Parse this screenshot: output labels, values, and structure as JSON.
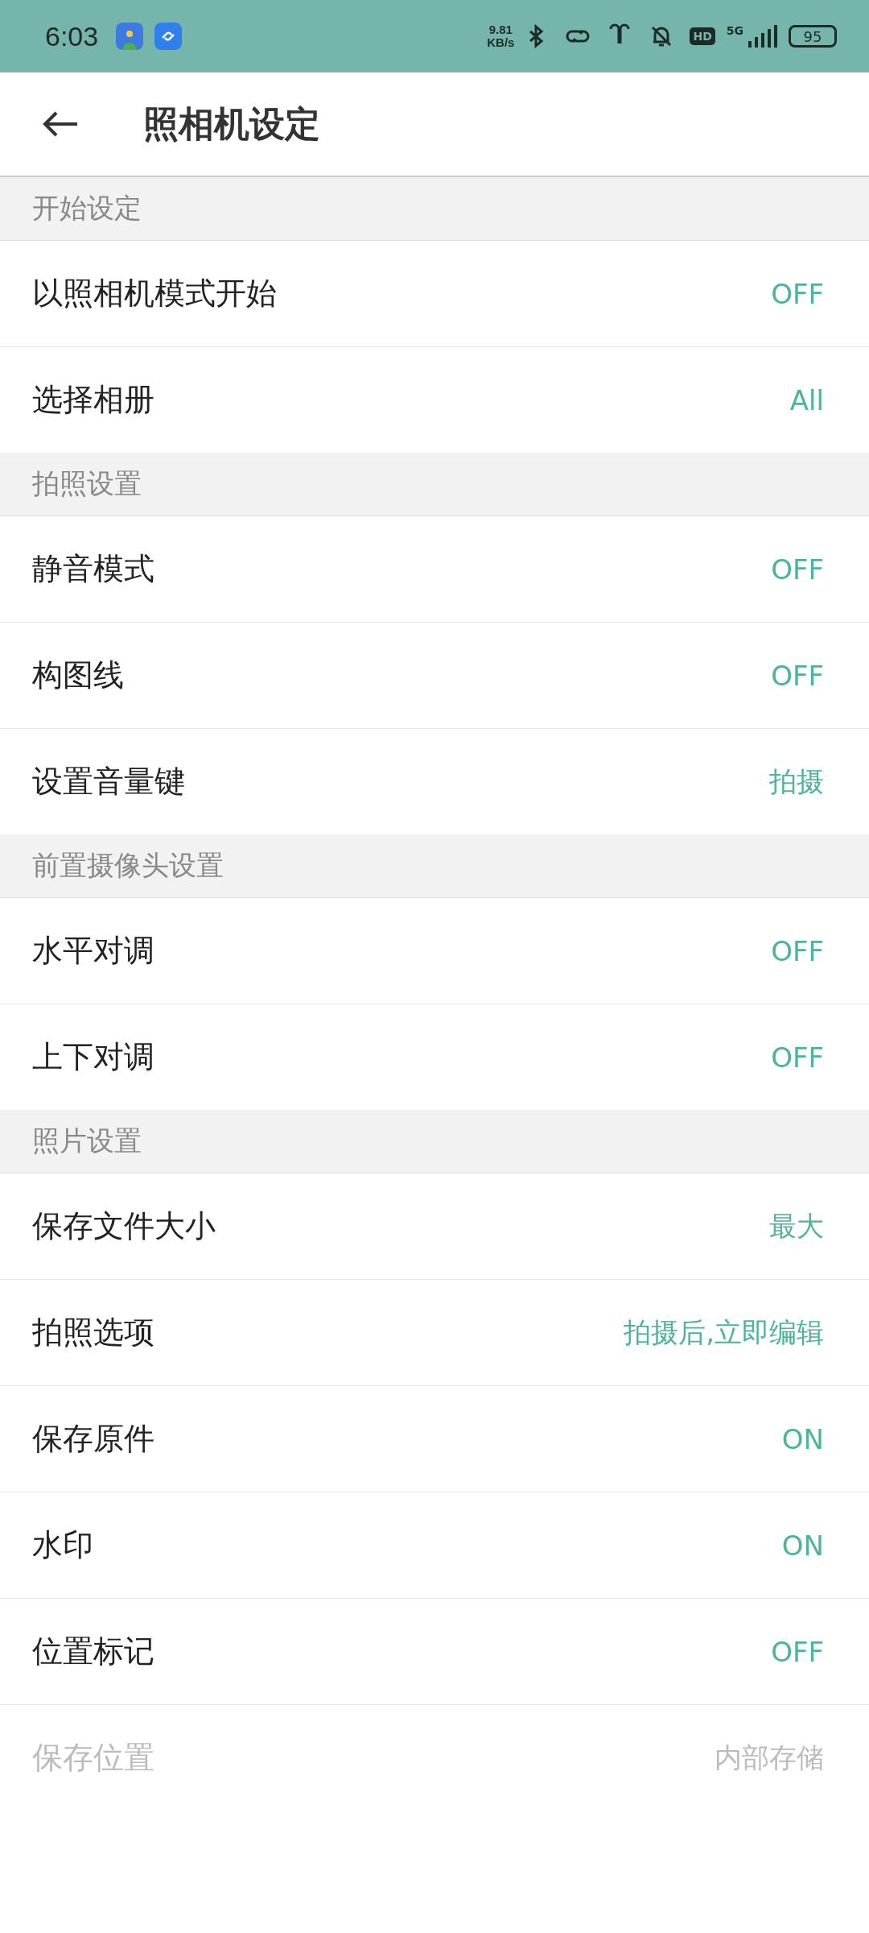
{
  "status_bar": {
    "time": "6:03",
    "net_speed": "9.81",
    "net_unit": "KB/s",
    "hd": "HD",
    "network": "5G",
    "battery": "95"
  },
  "header": {
    "title": "照相机设定"
  },
  "sections": [
    {
      "title": "开始设定",
      "rows": [
        {
          "label": "以照相机模式开始",
          "value": "OFF",
          "disabled": false
        },
        {
          "label": "选择相册",
          "value": "All",
          "disabled": false
        }
      ]
    },
    {
      "title": "拍照设置",
      "rows": [
        {
          "label": "静音模式",
          "value": "OFF",
          "disabled": false
        },
        {
          "label": "构图线",
          "value": "OFF",
          "disabled": false
        },
        {
          "label": "设置音量键",
          "value": "拍摄",
          "disabled": false
        }
      ]
    },
    {
      "title": "前置摄像头设置",
      "rows": [
        {
          "label": "水平对调",
          "value": "OFF",
          "disabled": false
        },
        {
          "label": "上下对调",
          "value": "OFF",
          "disabled": false
        }
      ]
    },
    {
      "title": "照片设置",
      "rows": [
        {
          "label": "保存文件大小",
          "value": "最大",
          "disabled": false
        },
        {
          "label": "拍照选项",
          "value": "拍摄后,立即编辑",
          "disabled": false
        },
        {
          "label": "保存原件",
          "value": "ON",
          "disabled": false
        },
        {
          "label": "水印",
          "value": "ON",
          "disabled": false
        },
        {
          "label": "位置标记",
          "value": "OFF",
          "disabled": false
        },
        {
          "label": "保存位置",
          "value": "内部存储",
          "disabled": true
        }
      ]
    }
  ]
}
